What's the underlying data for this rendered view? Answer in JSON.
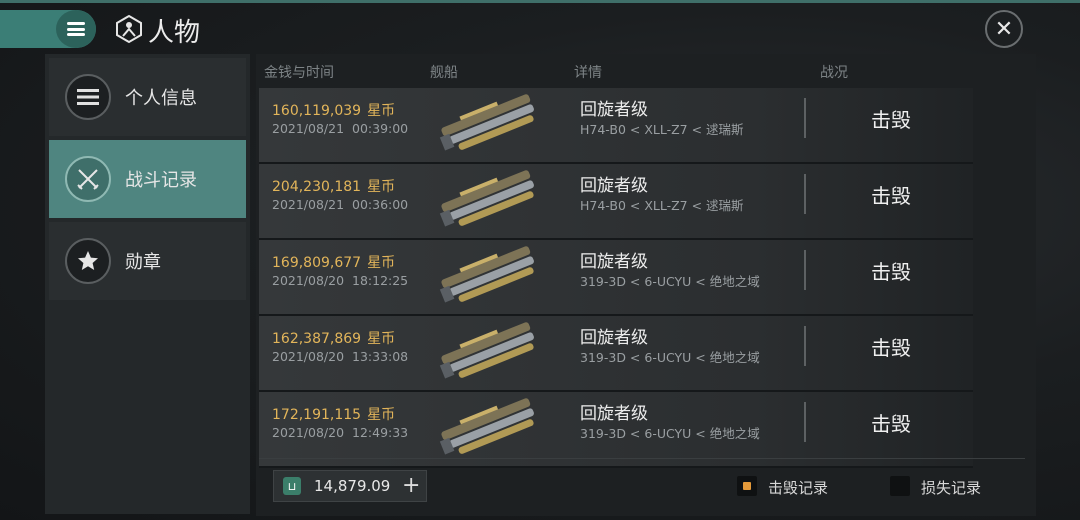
{
  "header": {
    "title": "人物",
    "menu_icon": "hamburger-icon",
    "character_icon": "character-emblem-icon",
    "close_icon": "close-icon"
  },
  "sidebar": {
    "items": [
      {
        "label": "个人信息",
        "icon": "list-icon",
        "active": false
      },
      {
        "label": "战斗记录",
        "icon": "crossed-swords-icon",
        "active": true
      },
      {
        "label": "勋章",
        "icon": "star-hexagon-icon",
        "active": false
      }
    ]
  },
  "columns": {
    "money_time": "金钱与时间",
    "ship": "舰船",
    "details": "详情",
    "result": "战况"
  },
  "records": [
    {
      "amount": "160,119,039",
      "unit": "星币",
      "date": "2021/08/21",
      "time": "00:39:00",
      "ship_class": "回旋者级",
      "location": "H74-B0 < XLL-Z7 < 逑瑞斯",
      "result": "击毁"
    },
    {
      "amount": "204,230,181",
      "unit": "星币",
      "date": "2021/08/21",
      "time": "00:36:00",
      "ship_class": "回旋者级",
      "location": "H74-B0 < XLL-Z7 < 逑瑞斯",
      "result": "击毁"
    },
    {
      "amount": "169,809,677",
      "unit": "星币",
      "date": "2021/08/20",
      "time": "18:12:25",
      "ship_class": "回旋者级",
      "location": "319-3D < 6-UCYU < 绝地之域",
      "result": "击毁"
    },
    {
      "amount": "162,387,869",
      "unit": "星币",
      "date": "2021/08/20",
      "time": "13:33:08",
      "ship_class": "回旋者级",
      "location": "319-3D < 6-UCYU < 绝地之域",
      "result": "击毁"
    },
    {
      "amount": "172,191,115",
      "unit": "星币",
      "date": "2021/08/20",
      "time": "12:49:33",
      "ship_class": "回旋者级",
      "location": "319-3D < 6-UCYU < 绝地之域",
      "result": "击毁"
    }
  ],
  "footer": {
    "plex_amount": "14,879.09",
    "plex_icon": "plex-icon",
    "add_label": "+",
    "kill_filter_label": "击毁记录",
    "kill_filter_checked": true,
    "loss_filter_label": "损失记录",
    "loss_filter_checked": false
  },
  "colors": {
    "accent": "#3b7e76",
    "money": "#e2b55a",
    "checkbox_mark": "#e59a3a"
  }
}
